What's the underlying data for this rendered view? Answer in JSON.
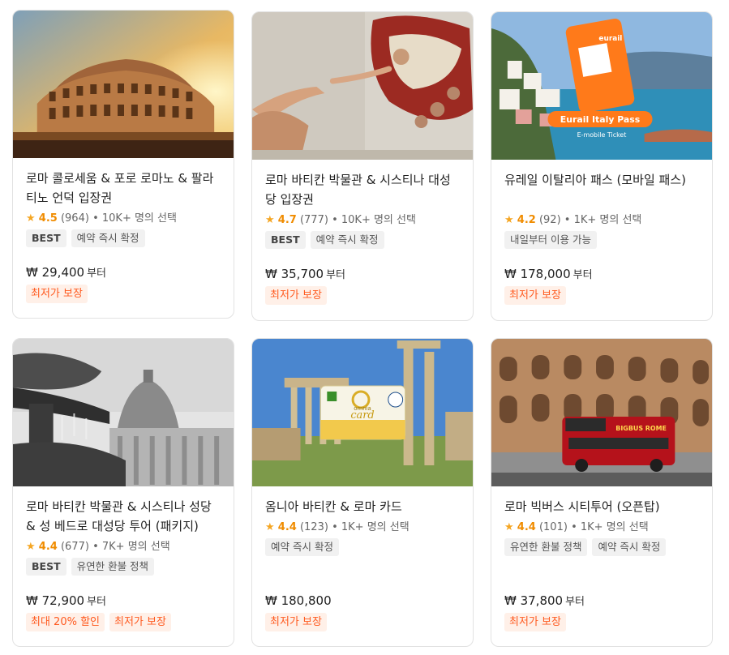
{
  "cards": [
    {
      "image": "colosseum-sunset-photo",
      "title": "로마 콜로세움 & 포로 로마노 & 팔라티노 언덕 입장권",
      "rating": "4.5",
      "reviews": "(964)",
      "booked": "• 10K+ 명의 선택",
      "tags": [
        "BEST",
        "예약 즉시 확정"
      ],
      "price": "₩ 29,400",
      "price_suffix": "부터",
      "promos": [
        "최저가 보장"
      ]
    },
    {
      "image": "creation-of-adam-fresco-photo",
      "title": "로마 바티칸 박물관 & 시스티나 대성당 입장권",
      "rating": "4.7",
      "reviews": "(777)",
      "booked": "• 10K+ 명의 선택",
      "tags": [
        "BEST",
        "예약 즉시 확정"
      ],
      "price": "₩ 35,700",
      "price_suffix": "부터",
      "promos": [
        "최저가 보장"
      ]
    },
    {
      "image": "eurail-italy-pass-coast-photo",
      "image_text": {
        "brand": "eurail",
        "pass": "Eurail Italy Pass",
        "sub": "E-mobile Ticket"
      },
      "title": "유레일 이탈리아 패스 (모바일 패스)",
      "rating": "4.2",
      "reviews": "(92)",
      "booked": "• 1K+ 명의 선택",
      "tags": [
        "내일부터 이용 가능"
      ],
      "price": "₩ 178,000",
      "price_suffix": "부터",
      "promos": [
        "최저가 보장"
      ]
    },
    {
      "image": "st-peters-basilica-fountain-photo",
      "title": "로마 바티칸 박물관 & 시스티나 성당 & 성 베드로 대성당 투어 (패키지)",
      "rating": "4.4",
      "reviews": "(677)",
      "booked": "• 7K+ 명의 선택",
      "tags": [
        "BEST",
        "유연한 환불 정책"
      ],
      "price": "₩ 72,900",
      "price_suffix": "부터",
      "promos": [
        "최대 20% 할인",
        "최저가 보장"
      ]
    },
    {
      "image": "roman-forum-omnia-card-photo",
      "image_text": {
        "brand": "omnia",
        "card": "card"
      },
      "title": "옴니아 바티칸 & 로마 카드",
      "rating": "4.4",
      "reviews": "(123)",
      "booked": "• 1K+ 명의 선택",
      "tags": [
        "예약 즉시 확정"
      ],
      "price": "₩ 180,800",
      "price_suffix": "",
      "promos": [
        "최저가 보장"
      ]
    },
    {
      "image": "big-bus-colosseum-photo",
      "image_text": {
        "bus": "BIGBUS ROME"
      },
      "title": "로마 빅버스 시티투어 (오픈탑)",
      "rating": "4.4",
      "reviews": "(101)",
      "booked": "• 1K+ 명의 선택",
      "tags": [
        "유연한 환불 정책",
        "예약 즉시 확정"
      ],
      "price": "₩ 37,800",
      "price_suffix": "부터",
      "promos": [
        "최저가 보장"
      ]
    }
  ],
  "colors": {
    "star": "#f5a623",
    "promo_text": "#ff5a1f",
    "promo_bg": "#fff0e8",
    "tag_bg": "#f1f1f1"
  }
}
